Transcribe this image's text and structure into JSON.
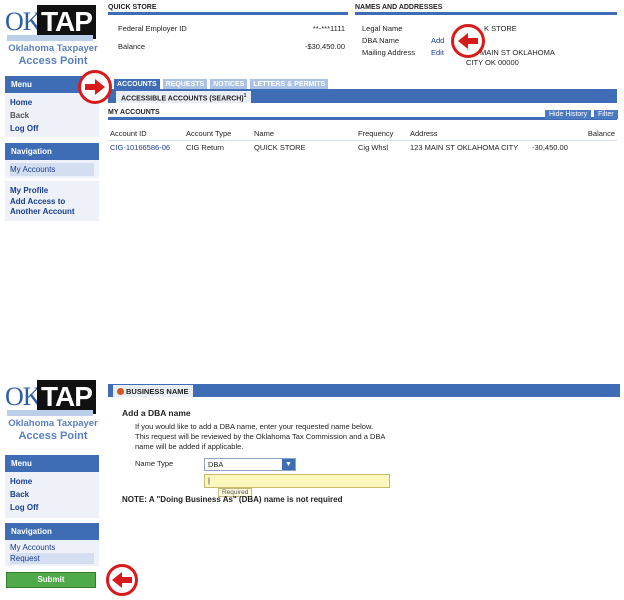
{
  "logo": {
    "ok": "OK",
    "tap": "TAP",
    "line1": "Oklahoma Taxpayer",
    "line2": "Access Point"
  },
  "top": {
    "menu": {
      "title": "Menu",
      "items": [
        "Home",
        "Back",
        "Log Off"
      ]
    },
    "navigation": {
      "title": "Navigation",
      "items": [
        "My Accounts"
      ]
    },
    "profile_links": [
      "My Profile",
      "Add Access to Another Account"
    ],
    "quick_store": {
      "title": "QUICK STORE",
      "fein_label": "Federal Employer ID",
      "fein_value": "**-***1111",
      "balance_label": "Balance",
      "balance_value": "-$30,450.00"
    },
    "names": {
      "title": "NAMES AND ADDRESSES",
      "legal_label": "Legal Name",
      "legal_value": "K STORE",
      "dba_label": "DBA Name",
      "dba_action": "Add",
      "mail_label": "Mailing Address",
      "mail_action": "Edit",
      "mail_line1": "MAIN ST OKLAHOMA",
      "mail_line2": "CITY OK 00000"
    },
    "tabs": [
      "ACCOUNTS",
      "REQUESTS",
      "NOTICES",
      "LETTERS & PERMITS"
    ],
    "sub_tab": "ACCESSIBLE ACCOUNTS (SEARCH)",
    "sub_tab_sup": "1",
    "my_accounts": "MY ACCOUNTS",
    "hide_history": "Hide History",
    "filter": "Filter",
    "table": {
      "headers": [
        "Account ID",
        "Account Type",
        "Name",
        "Frequency",
        "Address",
        "Balance"
      ],
      "rows": [
        [
          "CIG-10166586-06",
          "CIG Return",
          "QUICK STORE",
          "Cig Whsl",
          "123 MAIN ST OKLAHOMA CITY",
          "-30,450.00"
        ]
      ]
    }
  },
  "bottom": {
    "menu": {
      "title": "Menu",
      "items": [
        "Home",
        "Back",
        "Log Off"
      ]
    },
    "navigation": {
      "title": "Navigation",
      "items": [
        "My Accounts",
        "Request"
      ]
    },
    "submit": "Submit",
    "section_tab": "BUSINESS NAME",
    "form_title": "Add a DBA name",
    "form_desc": "If you would like to add a DBA name, enter your requested name below. This request will be reviewed by the Oklahoma Tax Commission and a DBA name will be added if applicable.",
    "name_type_label": "Name Type",
    "name_type_value": "DBA",
    "tooltip": "Required",
    "note": "NOTE: A \"Doing Business As\" (DBA) name is not required"
  },
  "colors": {
    "primary": "#3f6db5",
    "marker": "#d91a1a",
    "submit": "#4faa4b"
  }
}
